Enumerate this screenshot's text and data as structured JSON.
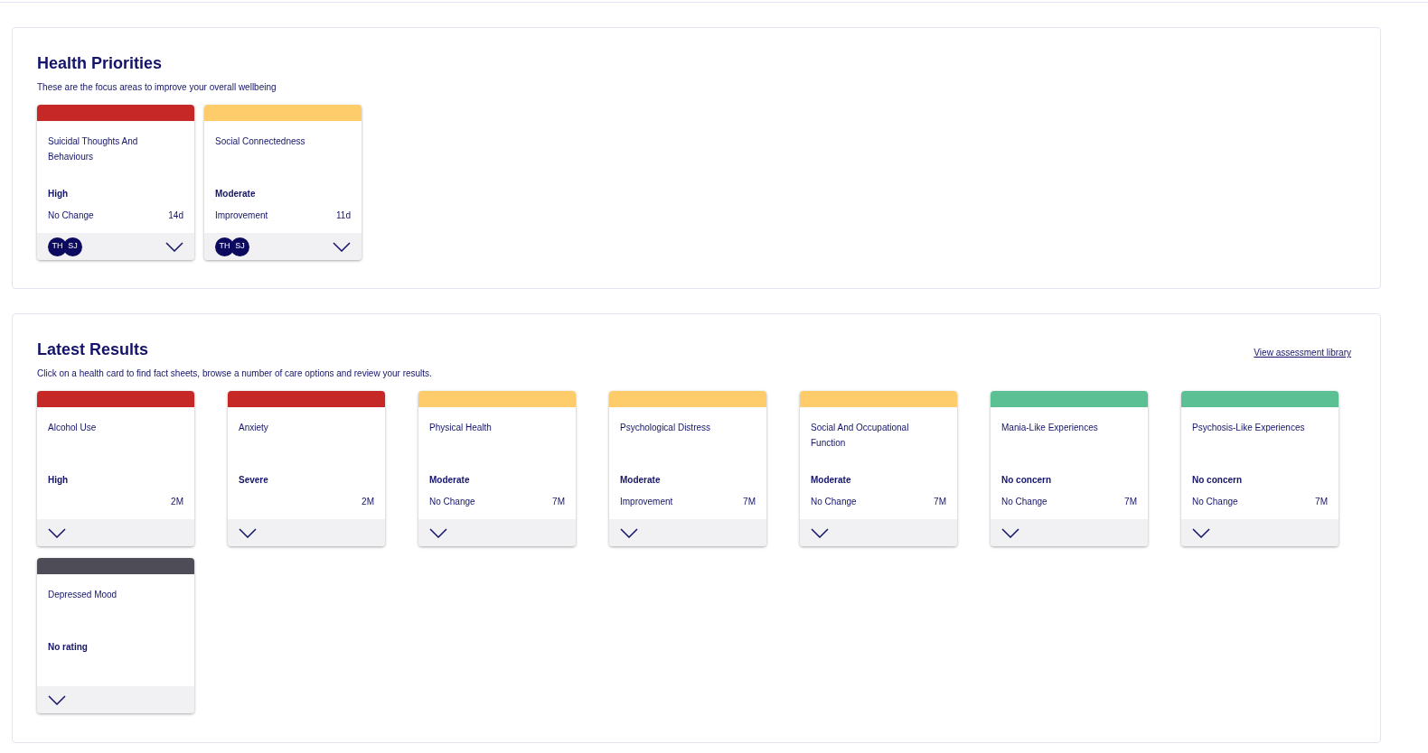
{
  "health_priorities": {
    "title": "Health Priorities",
    "subtitle": "These are the focus areas to improve your overall wellbeing",
    "cards": [
      {
        "title": "Suicidal Thoughts And Behaviours",
        "color": "#c62828",
        "rating": "High",
        "trend": "No Change",
        "age": "14d",
        "avatars": [
          "TH",
          "SJ"
        ]
      },
      {
        "title": "Social Connectedness",
        "color": "#ffcc6b",
        "rating": "Moderate",
        "trend": "Improvement",
        "age": "11d",
        "avatars": [
          "TH",
          "SJ"
        ]
      }
    ]
  },
  "latest_results": {
    "title": "Latest Results",
    "subtitle": "Click on a health card to find fact sheets, browse a number of care options and review your results.",
    "link": "View assessment library",
    "cards": [
      {
        "title": "Alcohol Use",
        "color": "#c62828",
        "rating": "High",
        "age": "2M"
      },
      {
        "title": "Anxiety",
        "color": "#c62828",
        "rating": "Severe",
        "age": "2M"
      },
      {
        "title": "Physical Health",
        "color": "#ffcc6b",
        "rating": "Moderate",
        "trend": "No Change",
        "age": "7M"
      },
      {
        "title": "Psychological Distress",
        "color": "#ffcc6b",
        "rating": "Moderate",
        "trend": "Improvement",
        "age": "7M"
      },
      {
        "title": "Social And Occupational Function",
        "color": "#ffcc6b",
        "rating": "Moderate",
        "trend": "No Change",
        "age": "7M"
      },
      {
        "title": "Mania-Like Experiences",
        "color": "#5cc095",
        "rating": "No concern",
        "trend": "No Change",
        "age": "7M"
      },
      {
        "title": "Psychosis-Like Experiences",
        "color": "#5cc095",
        "rating": "No concern",
        "trend": "No Change",
        "age": "7M"
      },
      {
        "title": "Depressed Mood",
        "color": "#4d4c57",
        "rating": "No rating"
      }
    ]
  }
}
